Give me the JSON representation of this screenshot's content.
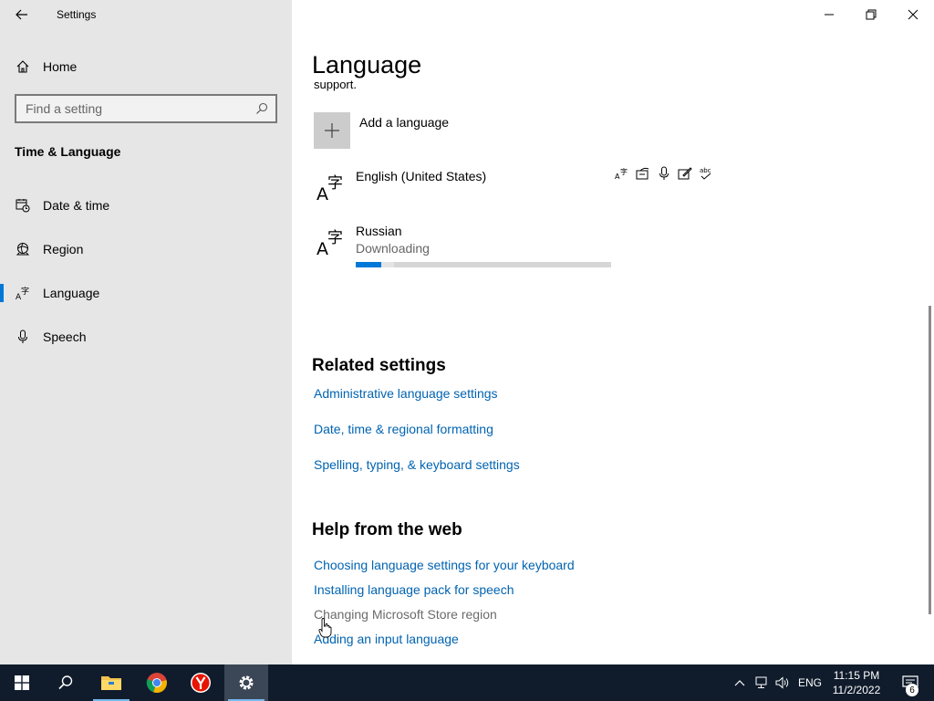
{
  "window": {
    "title": "Settings",
    "controls": [
      "minimize-icon",
      "restore-icon",
      "close-icon"
    ]
  },
  "sidebar": {
    "home_label": "Home",
    "search": {
      "placeholder": "Find a setting"
    },
    "section": "Time & Language",
    "items": [
      {
        "label": "Date & time",
        "icon": "calendar-clock-icon"
      },
      {
        "label": "Region",
        "icon": "globe-icon"
      },
      {
        "label": "Language",
        "icon": "language-icon",
        "active": true
      },
      {
        "label": "Speech",
        "icon": "microphone-icon"
      }
    ]
  },
  "main": {
    "title": "Language",
    "cut_text": "support.",
    "add_language_label": "Add a language",
    "languages": [
      {
        "name": "English (United States)",
        "status": "",
        "feature_icons": [
          "display-language-icon",
          "text-to-speech-icon",
          "speech-recognition-icon",
          "handwriting-icon",
          "spelling-icon"
        ]
      },
      {
        "name": "Russian",
        "status": "Downloading",
        "progress": 0.1,
        "buffered": 0.15
      }
    ],
    "related_settings": {
      "heading": "Related settings",
      "links": [
        "Administrative language settings",
        "Date, time & regional formatting",
        "Spelling, typing, & keyboard settings"
      ]
    },
    "help_from_web": {
      "heading": "Help from the web",
      "links": [
        "Choosing language settings for your keyboard",
        "Installing language pack for speech",
        "Changing Microsoft Store region",
        "Adding an input language"
      ]
    }
  },
  "taskbar": {
    "apps": [
      "start-icon",
      "search-icon",
      "file-explorer-icon",
      "chrome-icon",
      "yandex-icon",
      "settings-icon"
    ],
    "tray": {
      "input_language": "ENG",
      "time": "11:15 PM",
      "date": "11/2/2022",
      "notification_count": "6"
    }
  },
  "colors": {
    "accent": "#0078d7",
    "link": "#0063b1",
    "sidebar_bg": "#e6e6e6",
    "taskbar_bg": "#101c2c"
  }
}
